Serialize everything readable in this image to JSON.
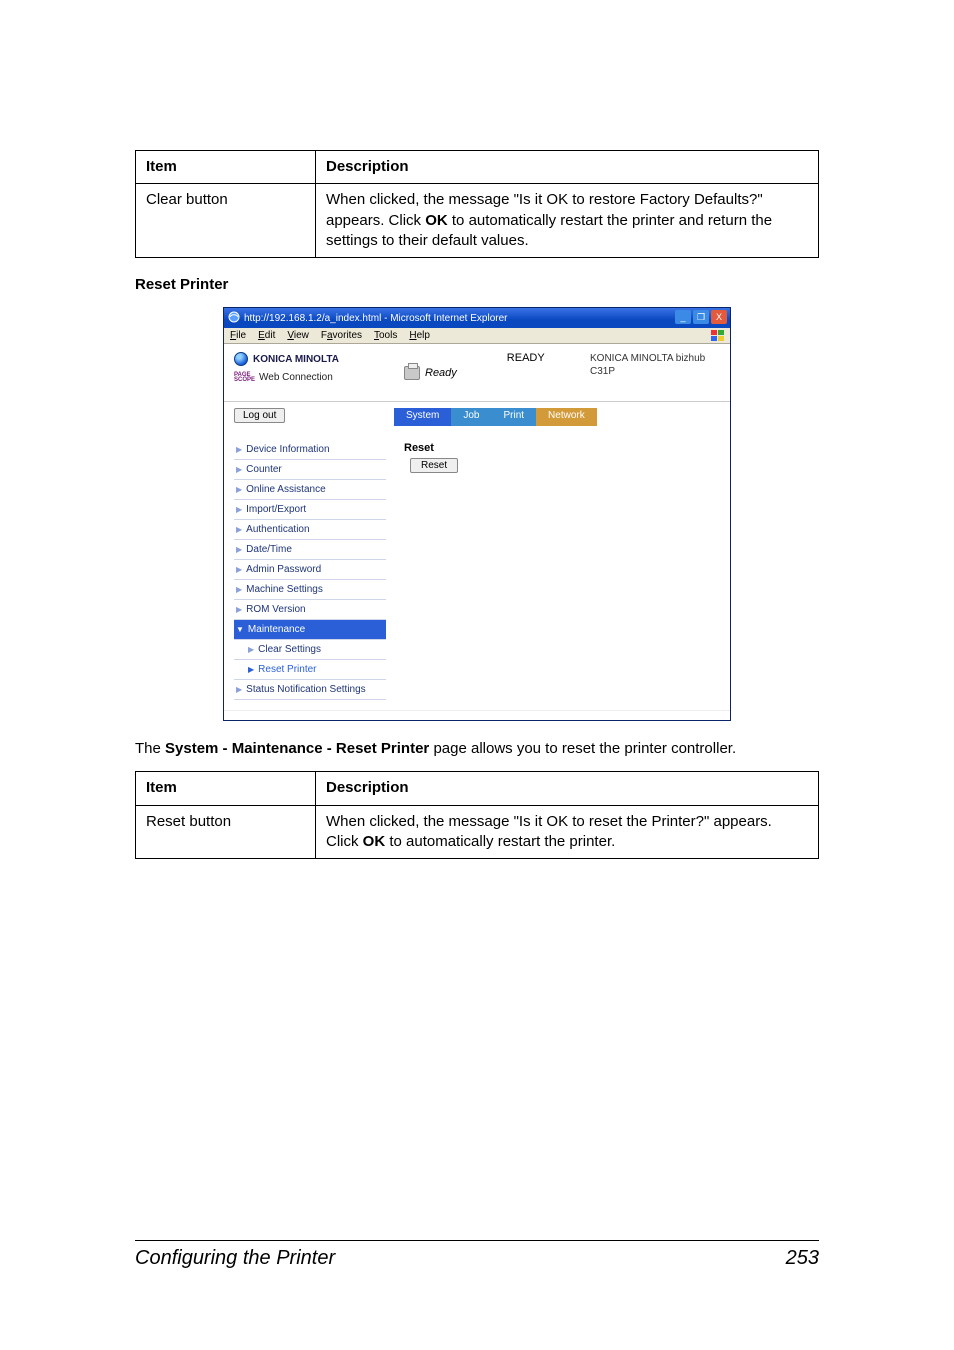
{
  "table1": {
    "headers": {
      "item": "Item",
      "desc": "Description"
    },
    "row": {
      "item": "Clear button",
      "desc_pre": "When clicked, the message \"Is it OK to restore Factory Defaults?\" appears. Click ",
      "desc_bold": "OK",
      "desc_post": " to automatically restart the printer and return the settings to their default values."
    }
  },
  "section": {
    "title": "Reset Printer"
  },
  "body": {
    "pre": "The ",
    "bold": "System - Maintenance - Reset Printer",
    "post": " page allows you to reset the printer controller."
  },
  "table2": {
    "headers": {
      "item": "Item",
      "desc": "Description"
    },
    "row": {
      "item": "Reset button",
      "desc_pre": "When clicked, the message \"Is it OK to reset the Printer?\" appears. Click ",
      "desc_bold": "OK",
      "desc_post": " to automatically restart the printer."
    }
  },
  "footer": {
    "left": "Configuring the Printer",
    "right": "253"
  },
  "shot": {
    "title": "http://192.168.1.2/a_index.html - Microsoft Internet Explorer",
    "menu": {
      "file": "File",
      "edit": "Edit",
      "view": "View",
      "favorites": "Favorites",
      "tools": "Tools",
      "help": "Help"
    },
    "brand": {
      "name": "KONICA MINOLTA",
      "wc_prefix": "PAGE SCOPE",
      "wc": "Web Connection"
    },
    "status": {
      "ready_label": "Ready",
      "ready_word": "READY"
    },
    "model": {
      "line1": "KONICA MINOLTA bizhub",
      "line2": "C31P"
    },
    "logout": "Log out",
    "tabs": {
      "system": "System",
      "job": "Job",
      "print": "Print",
      "network": "Network"
    },
    "sidebar": {
      "device_info": "Device Information",
      "counter": "Counter",
      "online": "Online Assistance",
      "import_export": "Import/Export",
      "auth": "Authentication",
      "datetime": "Date/Time",
      "admin_pw": "Admin Password",
      "machine": "Machine Settings",
      "rom": "ROM Version",
      "maintenance": "Maintenance",
      "clear_settings": "Clear Settings",
      "reset_printer": "Reset Printer",
      "status_notif": "Status Notification Settings"
    },
    "pane": {
      "title": "Reset",
      "button": "Reset"
    },
    "winbuttons": {
      "min": "_",
      "max": "❐",
      "close": "X"
    }
  }
}
